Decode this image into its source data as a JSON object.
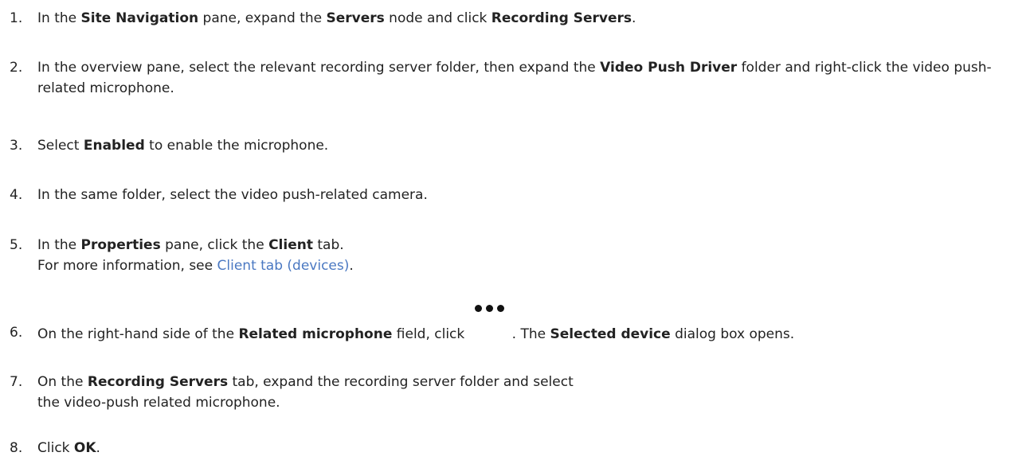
{
  "steps": [
    {
      "num": "1.",
      "t1": "In the ",
      "b1": "Site Navigation",
      "t2": " pane, expand the ",
      "b2": "Servers",
      "t3": " node and click ",
      "b3": "Recording Servers",
      "t4": "."
    },
    {
      "num": "2.",
      "t1": "In the overview pane, select the relevant recording server folder, then expand the ",
      "b1": "Video Push Driver",
      "t2": " folder and right-click the video push-related microphone."
    },
    {
      "num": "3.",
      "t1": "Select ",
      "b1": "Enabled",
      "t2": " to enable the microphone."
    },
    {
      "num": "4.",
      "t1": "In the same folder, select the video push-related camera."
    },
    {
      "num": "5.",
      "t1": "In the ",
      "b1": "Properties",
      "t2": " pane, click the ",
      "b2": "Client",
      "t3": " tab.",
      "line2_prefix": "For more information, see ",
      "link": "Client tab (devices)",
      "line2_suffix": "."
    },
    {
      "num": "6.",
      "t1": "On the right-hand side of the ",
      "b1": "Related microphone",
      "t2": " field, click ",
      "t3": ". The ",
      "b2": "Selected device",
      "t4": " dialog box opens.",
      "icon": "more-options-icon"
    },
    {
      "num": "7.",
      "t1": "On the ",
      "b1": "Recording Servers",
      "t2": " tab, expand the recording server folder and select the video-push related microphone."
    },
    {
      "num": "8.",
      "t1": "Click ",
      "b1": "OK",
      "t2": "."
    }
  ]
}
